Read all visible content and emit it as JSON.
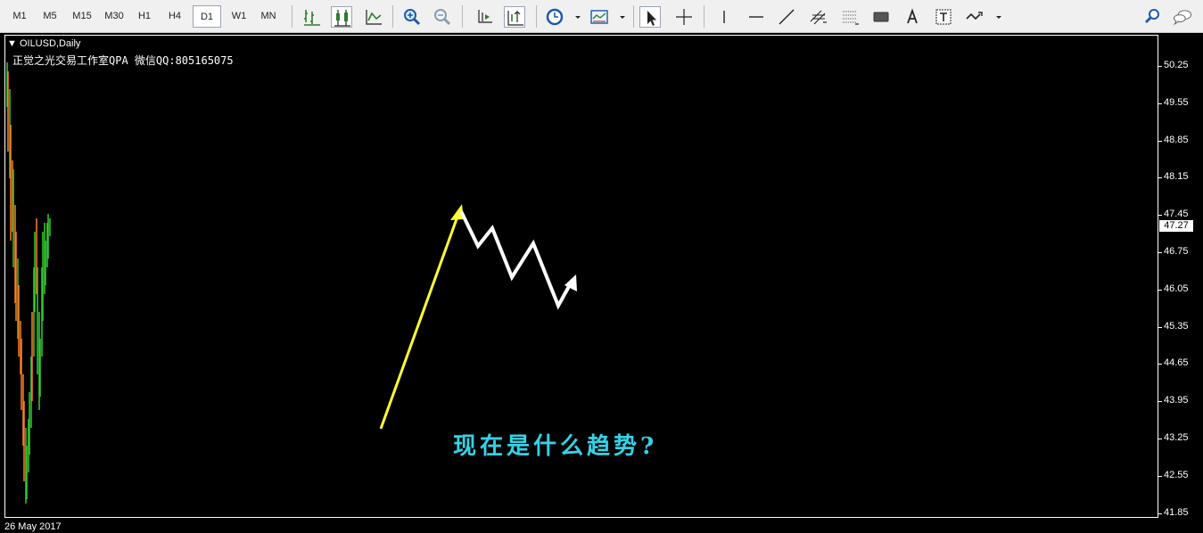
{
  "toolbar": {
    "timeframes": [
      "M1",
      "M5",
      "M15",
      "M30",
      "H1",
      "H4",
      "D1",
      "W1",
      "MN"
    ],
    "active_timeframe": "D1"
  },
  "chart": {
    "symbol": "OILUSD,Daily",
    "watermark": "正觉之光交易工作室QPA 微信QQ:805165075",
    "annotation": "现在是什么趋势?",
    "date_label": "26 May 2017",
    "current_price": "47.27",
    "price_levels": [
      "50.25",
      "49.55",
      "48.85",
      "48.15",
      "47.45",
      "46.75",
      "46.05",
      "45.35",
      "44.65",
      "43.95",
      "43.25",
      "42.55",
      "41.85"
    ],
    "colors": {
      "background": "#000000",
      "bull": "#32cd32",
      "bear": "#ff7f27",
      "arrow_up": "#ffff33",
      "zigzag": "#ffffff",
      "annotation": "#35d2e6"
    }
  }
}
